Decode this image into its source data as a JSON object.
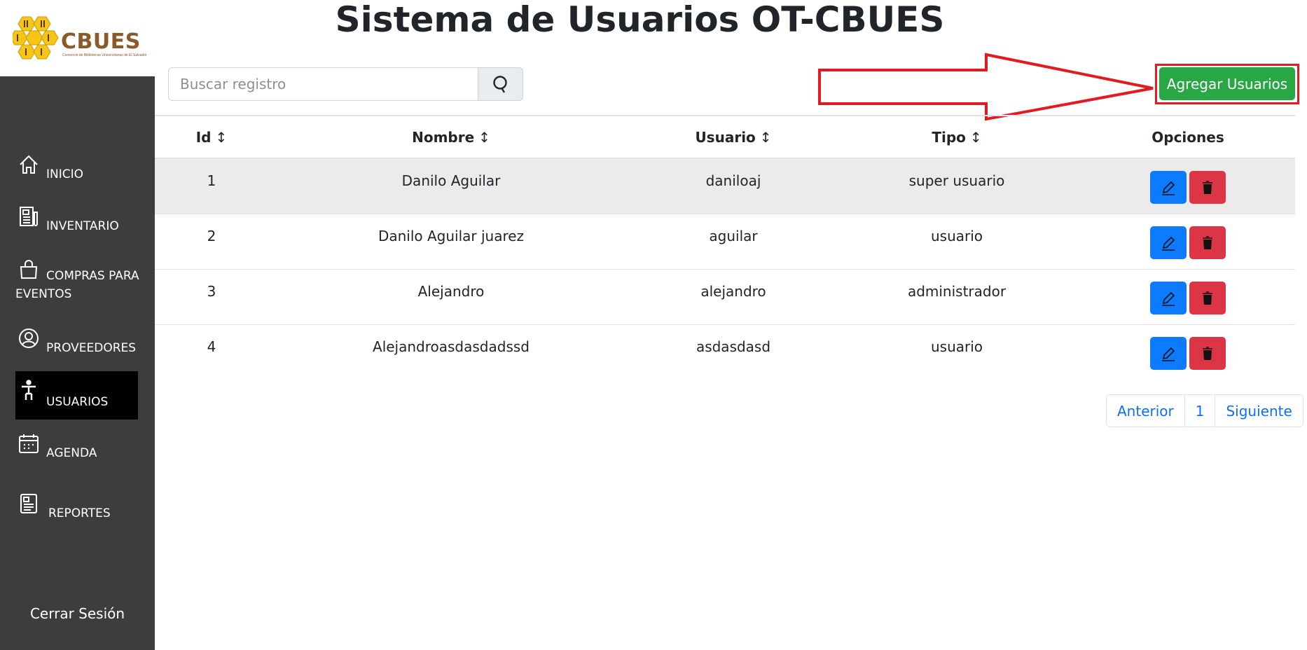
{
  "app": {
    "title": "Sistema de Usuarios OT-CBUES",
    "logo_text": "CBUES",
    "logo_subtitle": "Consorcio de Bibliotecas Universitarias de El Salvador"
  },
  "sidebar": {
    "items": [
      {
        "label": "INICIO",
        "icon": "home-icon"
      },
      {
        "label": "INVENTARIO",
        "icon": "newspaper-icon"
      },
      {
        "label": "COMPRAS PARA EVENTOS",
        "icon": "shopping-bag-icon"
      },
      {
        "label": "PROVEEDORES",
        "icon": "person-circle-icon"
      },
      {
        "label": "USUARIOS",
        "icon": "person-standing-icon",
        "active": true
      },
      {
        "label": "AGENDA",
        "icon": "calendar-icon"
      },
      {
        "label": "REPORTES",
        "icon": "report-icon"
      }
    ],
    "logout_label": "Cerrar Sesión"
  },
  "toolbar": {
    "search_placeholder": "Buscar registro",
    "add_button_label": "Agregar Usuarios",
    "highlight_color": "#e11b22",
    "add_button_color": "#28a745"
  },
  "table": {
    "headers": [
      {
        "label": "Id",
        "sortable": true
      },
      {
        "label": "Nombre",
        "sortable": true
      },
      {
        "label": "Usuario",
        "sortable": true
      },
      {
        "label": "Tipo",
        "sortable": true
      },
      {
        "label": "Opciones",
        "sortable": false
      }
    ],
    "rows": [
      {
        "id": "1",
        "nombre": "Danilo Aguilar",
        "usuario": "daniloaj",
        "tipo": "super usuario"
      },
      {
        "id": "2",
        "nombre": "Danilo Aguilar juarez",
        "usuario": "aguilar",
        "tipo": "usuario"
      },
      {
        "id": "3",
        "nombre": "Alejandro",
        "usuario": "alejandro",
        "tipo": "administrador"
      },
      {
        "id": "4",
        "nombre": "Alejandroasdasdadssd",
        "usuario": "asdasdasd",
        "tipo": "usuario"
      }
    ]
  },
  "pagination": {
    "prev_label": "Anterior",
    "current_page": "1",
    "next_label": "Siguiente"
  }
}
